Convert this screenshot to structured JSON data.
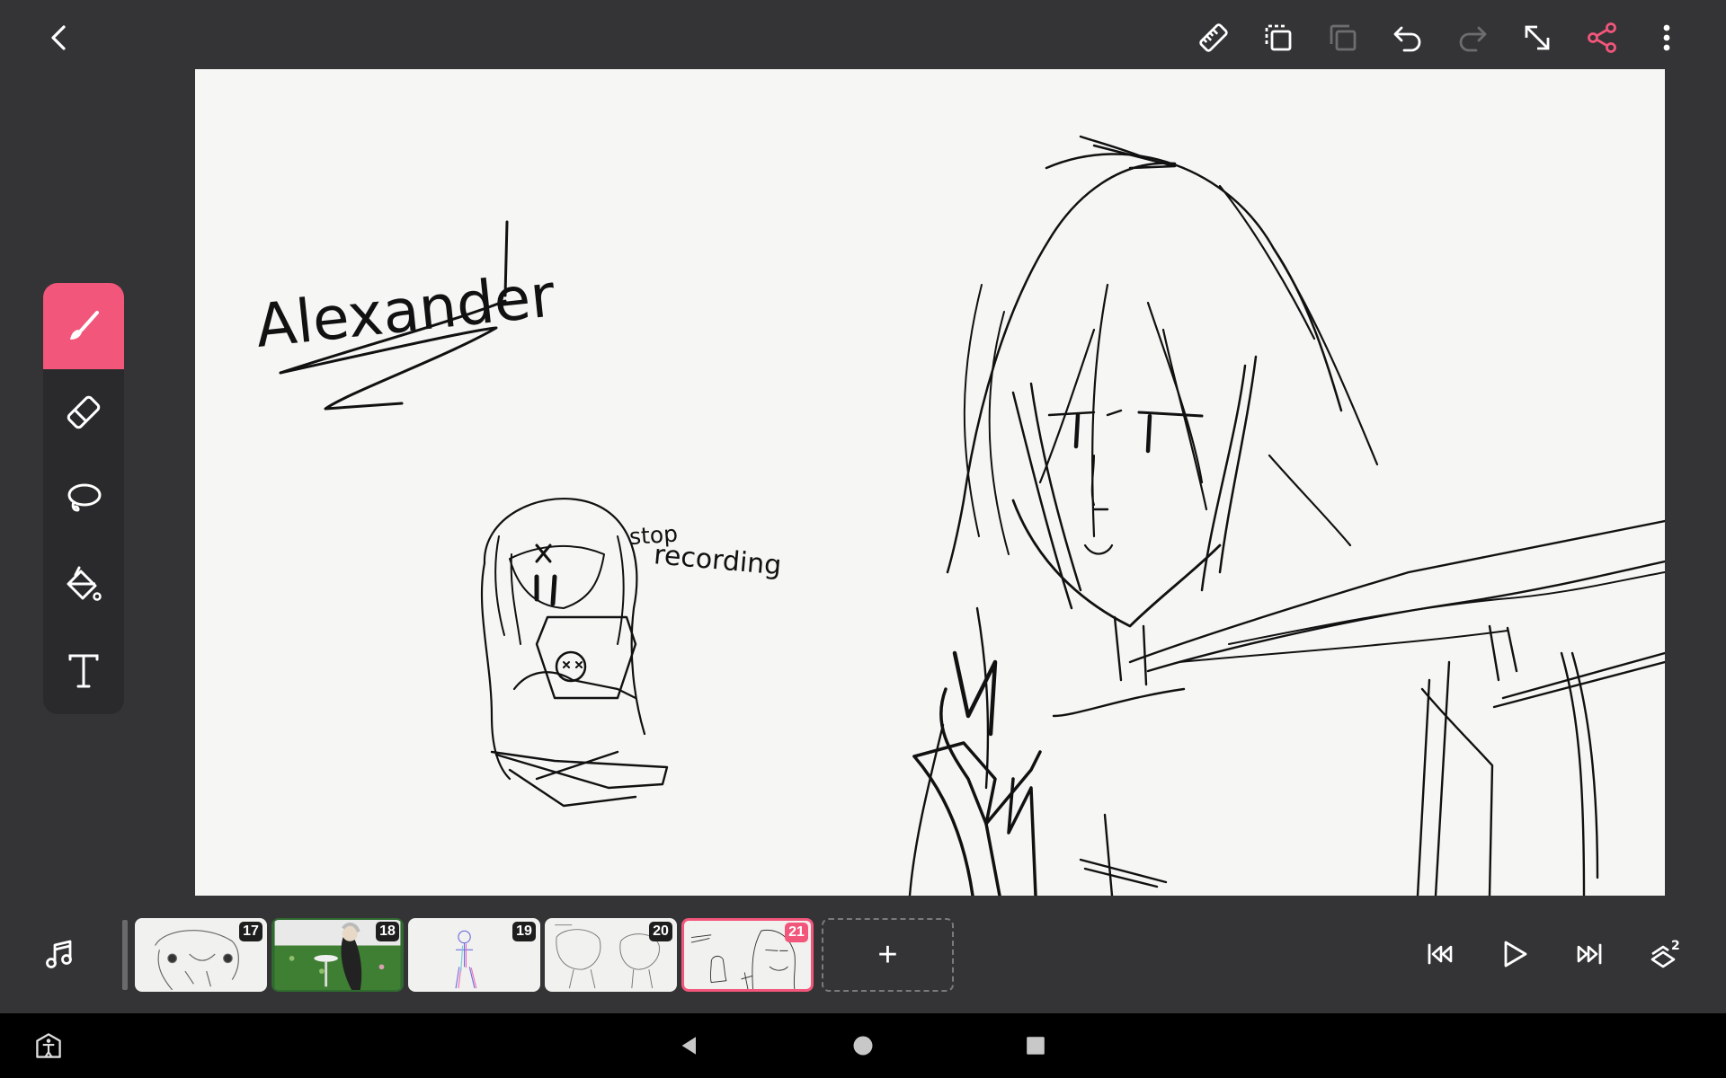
{
  "colors": {
    "accent": "#f2567b",
    "background": "#343436",
    "canvas": "#f6f6f4",
    "palette": "#2a2a2c"
  },
  "topbar": {
    "icons": [
      "back-icon",
      "ruler-icon",
      "copy-frame-icon",
      "paste-frame-icon",
      "undo-icon",
      "redo-icon",
      "resize-icon",
      "share-icon",
      "more-icon"
    ]
  },
  "canvas": {
    "title_text": "Alexander",
    "annotation_line1": "stop",
    "annotation_line2": "recording"
  },
  "tools": [
    {
      "name": "brush",
      "icon": "brush-icon",
      "active": true
    },
    {
      "name": "eraser",
      "icon": "eraser-icon",
      "active": false
    },
    {
      "name": "lasso",
      "icon": "lasso-icon",
      "active": false
    },
    {
      "name": "fill",
      "icon": "fill-bucket-icon",
      "active": false
    },
    {
      "name": "text",
      "icon": "text-icon",
      "active": false
    }
  ],
  "timeline": {
    "frames": [
      {
        "number": "17",
        "active": false
      },
      {
        "number": "18",
        "active": false
      },
      {
        "number": "19",
        "active": false
      },
      {
        "number": "20",
        "active": false
      },
      {
        "number": "21",
        "active": true
      }
    ],
    "add_label": "+",
    "layers_count": "2"
  }
}
